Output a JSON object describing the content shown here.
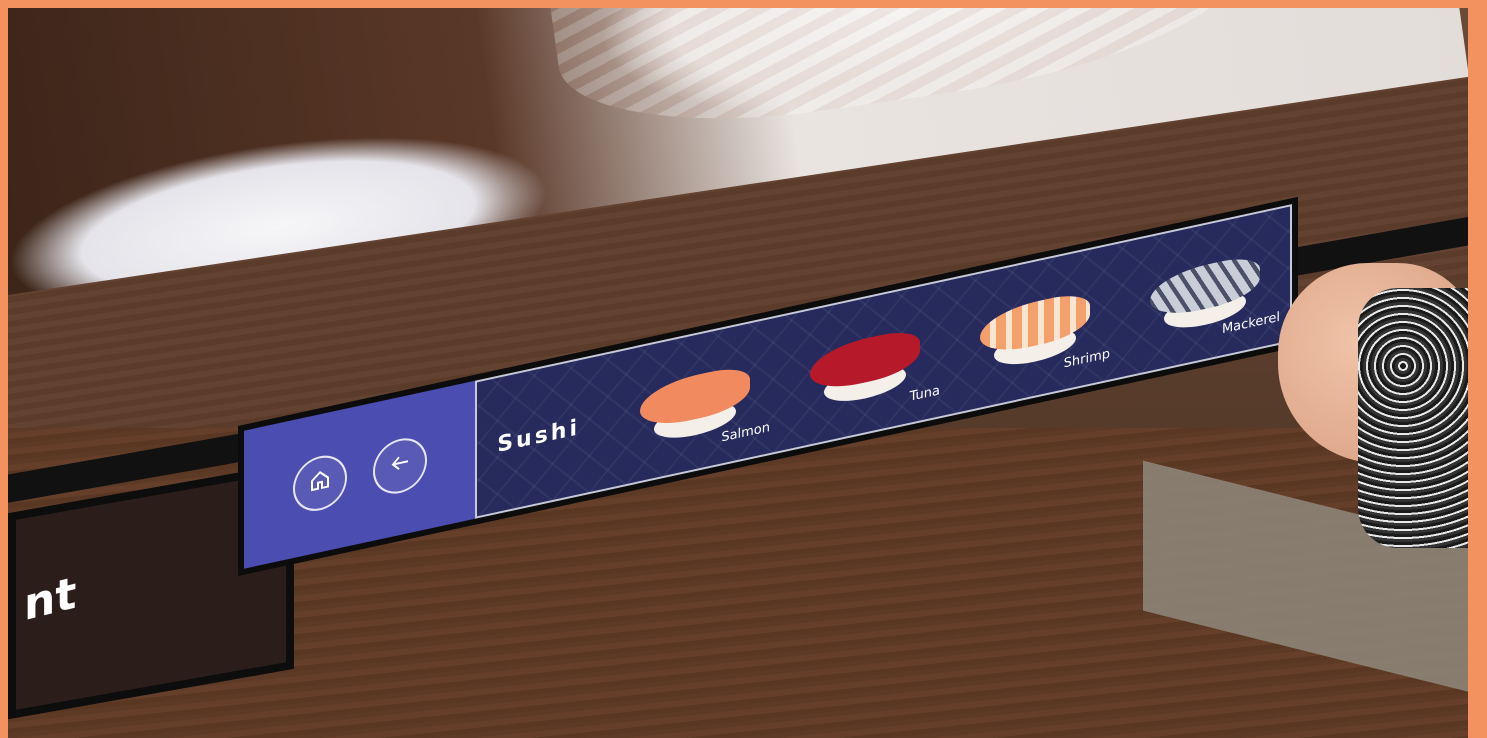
{
  "side_panel": {
    "text": "nt"
  },
  "nav": {
    "home_icon": "home-icon",
    "back_icon": "arrow-left-icon"
  },
  "menu": {
    "category": "Sushi",
    "items": [
      {
        "label": "Salmon",
        "fish_color": "#f28a5f"
      },
      {
        "label": "Tuna",
        "fish_color": "#b5192a"
      },
      {
        "label": "Shrimp",
        "fish_color": "#f3a06c"
      },
      {
        "label": "Mackerel",
        "fish_color": "#c9cdd8"
      }
    ]
  },
  "colors": {
    "nav_bg": "#4b4db0",
    "menu_bg": "#262a5c",
    "frame_border": "#f4925f"
  }
}
